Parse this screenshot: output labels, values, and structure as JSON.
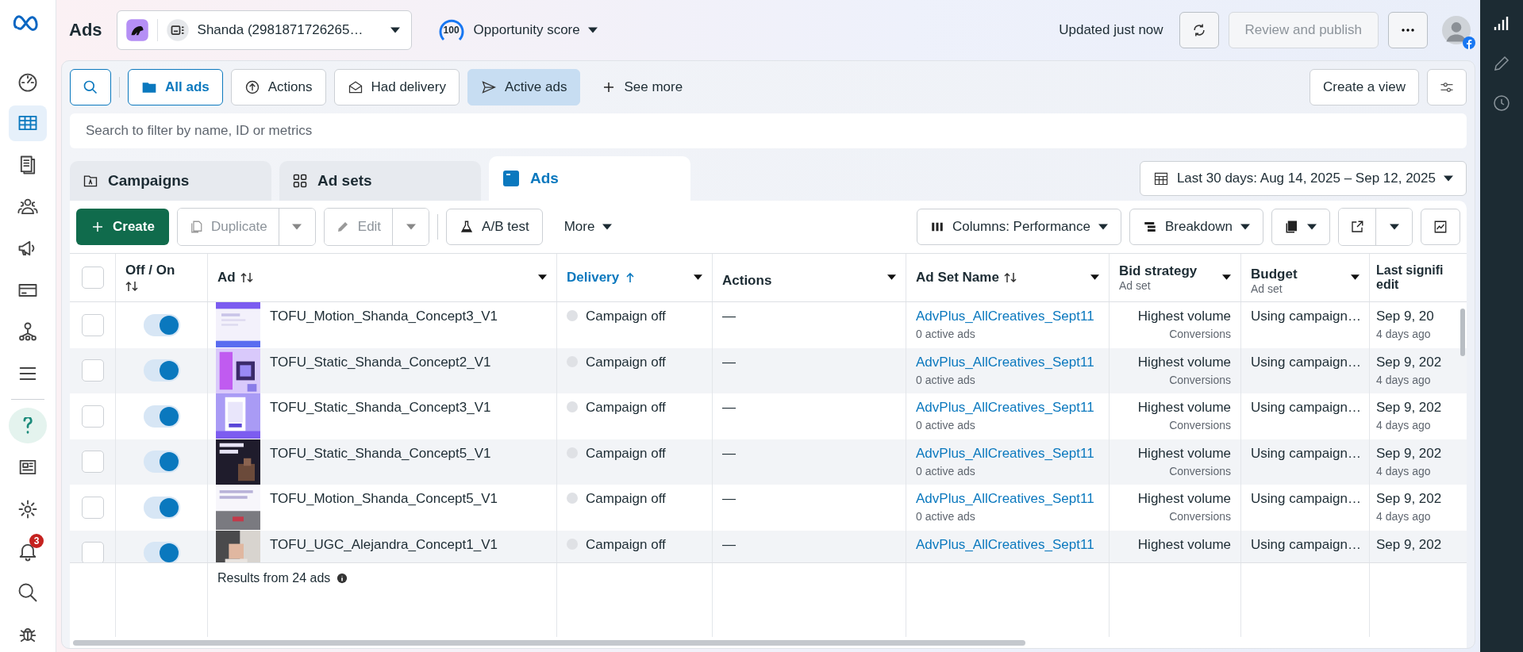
{
  "header": {
    "title": "Ads",
    "account": "Shanda (2981871726265…",
    "score": "100",
    "score_label": "Opportunity score",
    "updated": "Updated just now",
    "review_button": {
      "label": "Review and publish",
      "disabled": true
    }
  },
  "sidebar": {
    "items": [
      {
        "selected": false
      },
      {
        "selected": true
      },
      {
        "selected": false
      },
      {
        "selected": false
      },
      {
        "selected": false
      },
      {
        "selected": false
      },
      {
        "selected": false
      },
      {
        "selected": false
      },
      {
        "selected": false
      },
      {
        "selected": false
      },
      {
        "selected": false
      },
      {
        "selected": false,
        "badge": "3"
      },
      {
        "selected": false
      },
      {
        "selected": false
      }
    ]
  },
  "filters": {
    "chips": [
      {
        "label": "All ads",
        "selected": true,
        "applied": false
      },
      {
        "label": "Actions",
        "selected": false,
        "applied": false
      },
      {
        "label": "Had delivery",
        "selected": false,
        "applied": false
      },
      {
        "label": "Active ads",
        "selected": false,
        "applied": true
      }
    ],
    "see_more": "See more",
    "create_view": "Create a view",
    "search_placeholder": "Search to filter by name, ID or metrics"
  },
  "level_tabs": [
    {
      "label": "Campaigns",
      "selected": false
    },
    {
      "label": "Ad sets",
      "selected": false
    },
    {
      "label": "Ads",
      "selected": true
    }
  ],
  "date_range": "Last 30 days: Aug 14, 2025 – Sep 12, 2025",
  "toolbar": {
    "create": "Create",
    "duplicate": {
      "label": "Duplicate",
      "disabled": true
    },
    "edit": {
      "label": "Edit",
      "disabled": true
    },
    "ab_test": "A/B test",
    "more": "More",
    "columns": "Columns: Performance",
    "breakdown": "Breakdown"
  },
  "table": {
    "all_selected": false,
    "columns": [
      {
        "label": "Off / On",
        "sortable": true
      },
      {
        "label": "Ad",
        "sortable": true
      },
      {
        "label": "Delivery",
        "sorted_ascending": true
      },
      {
        "label": "Actions"
      },
      {
        "label": "Ad Set Name",
        "sortable": true
      },
      {
        "label": "Bid strategy",
        "sub": "Ad set"
      },
      {
        "label": "Budget",
        "sub": "Ad set"
      },
      {
        "label": "Last signifi",
        "line2": "edit"
      }
    ],
    "rows": [
      {
        "selected": false,
        "on": true,
        "ad": "TOFU_Motion_Shanda_Concept3_V1",
        "delivery": "Campaign off",
        "actions": "—",
        "ad_set": "AdvPlus_AllCreatives_Sept11",
        "ad_set_sub": "0 active ads",
        "bid": "Highest volume",
        "bid_sub": "Conversions",
        "budget": "Using campaign…",
        "last_edit": "Sep 9, 20",
        "last_edit_sub": "4 days ago"
      },
      {
        "selected": false,
        "on": true,
        "ad": "TOFU_Static_Shanda_Concept2_V1",
        "delivery": "Campaign off",
        "actions": "—",
        "ad_set": "AdvPlus_AllCreatives_Sept11",
        "ad_set_sub": "0 active ads",
        "bid": "Highest volume",
        "bid_sub": "Conversions",
        "budget": "Using campaign…",
        "last_edit": "Sep 9, 202",
        "last_edit_sub": "4 days ago"
      },
      {
        "selected": false,
        "on": true,
        "ad": "TOFU_Static_Shanda_Concept3_V1",
        "delivery": "Campaign off",
        "actions": "—",
        "ad_set": "AdvPlus_AllCreatives_Sept11",
        "ad_set_sub": "0 active ads",
        "bid": "Highest volume",
        "bid_sub": "Conversions",
        "budget": "Using campaign…",
        "last_edit": "Sep 9, 202",
        "last_edit_sub": "4 days ago"
      },
      {
        "selected": false,
        "on": true,
        "ad": "TOFU_Static_Shanda_Concept5_V1",
        "delivery": "Campaign off",
        "actions": "—",
        "ad_set": "AdvPlus_AllCreatives_Sept11",
        "ad_set_sub": "0 active ads",
        "bid": "Highest volume",
        "bid_sub": "Conversions",
        "budget": "Using campaign…",
        "last_edit": "Sep 9, 202",
        "last_edit_sub": "4 days ago"
      },
      {
        "selected": false,
        "on": true,
        "ad": "TOFU_Motion_Shanda_Concept5_V1",
        "delivery": "Campaign off",
        "actions": "—",
        "ad_set": "AdvPlus_AllCreatives_Sept11",
        "ad_set_sub": "0 active ads",
        "bid": "Highest volume",
        "bid_sub": "Conversions",
        "budget": "Using campaign…",
        "last_edit": "Sep 9, 202",
        "last_edit_sub": "4 days ago"
      },
      {
        "selected": false,
        "on": true,
        "ad": "TOFU_UGC_Alejandra_Concept1_V1",
        "delivery": "Campaign off",
        "actions": "—",
        "ad_set": "AdvPlus_AllCreatives_Sept11",
        "bid": "Highest volume",
        "budget": "Using campaign…",
        "last_edit": "Sep 9, 202"
      }
    ],
    "footer": "Results from 24 ads"
  }
}
